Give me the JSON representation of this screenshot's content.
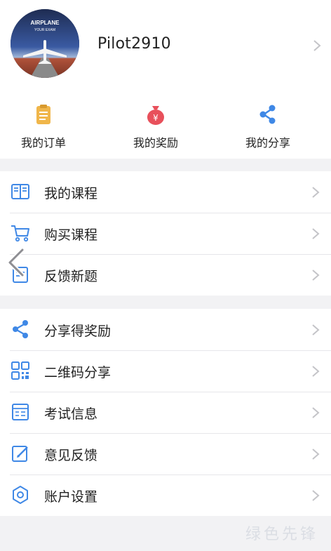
{
  "profile": {
    "username": "Pilot2910",
    "avatar_text": [
      "AIRPLANE",
      "YOUR EXAM"
    ]
  },
  "quick_actions": [
    {
      "label": "我的订单",
      "icon": "clipboard-icon",
      "color": "#f0b64a"
    },
    {
      "label": "我的奖励",
      "icon": "money-bag-icon",
      "color": "#e8505b"
    },
    {
      "label": "我的分享",
      "icon": "share-icon",
      "color": "#3f88e6"
    }
  ],
  "section1": [
    {
      "label": "我的课程",
      "icon": "book-icon"
    },
    {
      "label": "购买课程",
      "icon": "cart-icon"
    },
    {
      "label": "反馈新题",
      "icon": "feedback-icon"
    }
  ],
  "section2": [
    {
      "label": "分享得奖励",
      "icon": "share-icon"
    },
    {
      "label": "二维码分享",
      "icon": "qr-code-icon"
    },
    {
      "label": "考试信息",
      "icon": "exam-info-icon"
    },
    {
      "label": "意见反馈",
      "icon": "edit-icon"
    },
    {
      "label": "账户设置",
      "icon": "settings-icon"
    }
  ],
  "watermark": "绿色先锋",
  "colors": {
    "accent": "#3f88e6",
    "background": "#f2f2f4",
    "chevron": "#c4c4c8"
  }
}
